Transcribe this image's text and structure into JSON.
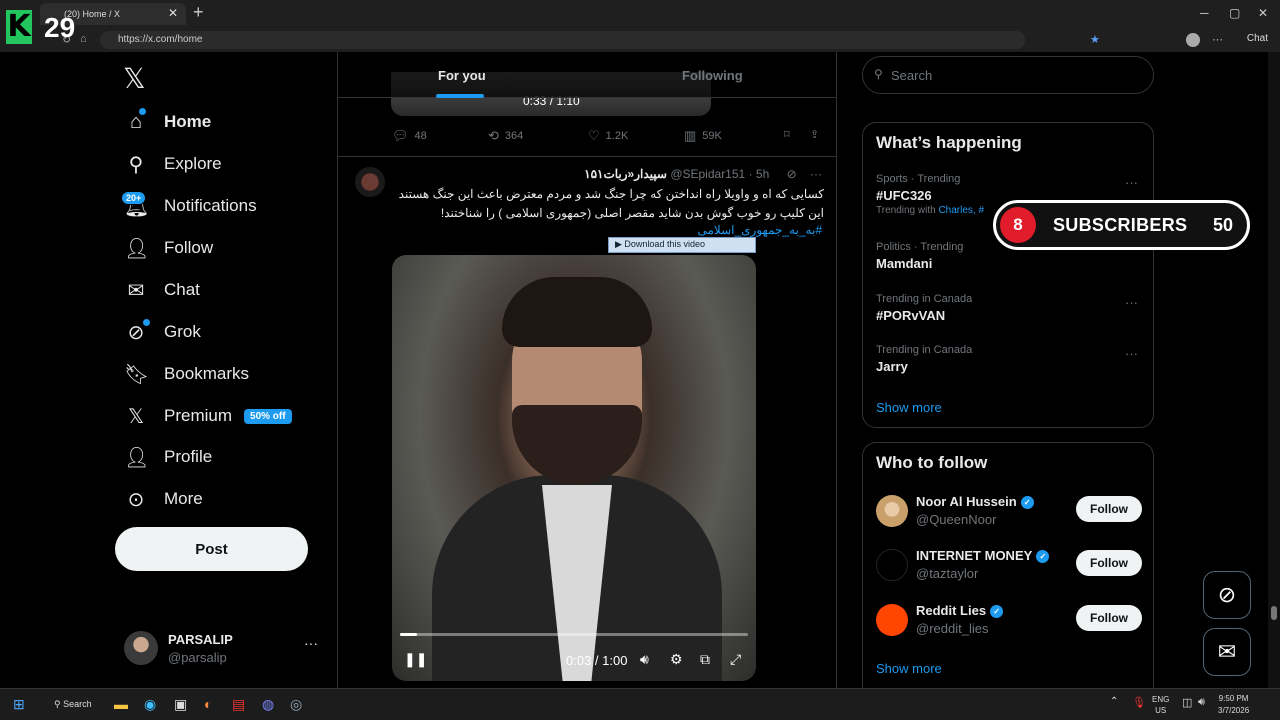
{
  "browser": {
    "tab_title": "(20) Home / X",
    "url": "https://x.com/home",
    "chat_label": "Chat"
  },
  "overlay_top": {
    "k_letter": "K",
    "count": "29"
  },
  "nav": {
    "items": [
      {
        "label": "Home",
        "icon": "home-icon"
      },
      {
        "label": "Explore",
        "icon": "search-icon"
      },
      {
        "label": "Notifications",
        "icon": "bell-icon",
        "badge": "20+"
      },
      {
        "label": "Follow",
        "icon": "person-add-icon"
      },
      {
        "label": "Chat",
        "icon": "mail-icon"
      },
      {
        "label": "Grok",
        "icon": "grok-icon"
      },
      {
        "label": "Bookmarks",
        "icon": "bookmark-icon"
      },
      {
        "label": "Premium",
        "icon": "x-logo-icon",
        "badge": "50% off"
      },
      {
        "label": "Profile",
        "icon": "person-icon"
      },
      {
        "label": "More",
        "icon": "more-circle-icon"
      }
    ],
    "post_label": "Post",
    "user": {
      "name": "PARSALIP",
      "handle": "@parsalip"
    }
  },
  "feed": {
    "tabs": [
      "For you",
      "Following"
    ],
    "prev_post": {
      "video_time": "0:33 / 1:10",
      "replies": "48",
      "reposts": "364",
      "likes": "1.2K",
      "views": "59K"
    },
    "tweet": {
      "name": "سپیدار«ربات۱۵۱",
      "handle": "@SEpidar151",
      "time": "· 5h",
      "text": "کسایی که اه و واویلا راه انداختن که چرا جنگ شد و مردم معترض باعث این جنگ هستند این کلیپ رو خوب گوش بدن شاید مقصر اصلی (جمهوری اسلامی ) را شناختند!",
      "hashtag": "#به_به_جمهوری_اسلامی",
      "download_label": "▶ Download this video",
      "video": {
        "time": "0:03 / 1:00",
        "progress": 0.05
      }
    }
  },
  "sidebar": {
    "search_placeholder": "Search",
    "whats_happening": {
      "title": "What’s happening",
      "trends": [
        {
          "category": "Sports · Trending",
          "name": "#UFC326",
          "sub_prefix": "Trending with",
          "sub_link": "Charles, #"
        },
        {
          "category": "Politics · Trending",
          "name": "Mamdani"
        },
        {
          "category": "Trending in Canada",
          "name": "#PORvVAN"
        },
        {
          "category": "Trending in Canada",
          "name": "Jarry"
        }
      ],
      "show_more": "Show more"
    },
    "who_to_follow": {
      "title": "Who to follow",
      "accounts": [
        {
          "name": "Noor Al Hussein",
          "handle": "@QueenNoor",
          "button": "Follow"
        },
        {
          "name": "INTERNET MONEY",
          "handle": "@taztaylor",
          "button": "Follow"
        },
        {
          "name": "Reddit Lies",
          "handle": "@reddit_lies",
          "button": "Follow"
        }
      ],
      "show_more": "Show more"
    }
  },
  "subscriber_overlay": {
    "left_number": "8",
    "label": "SUBSCRIBERS",
    "count": "50"
  },
  "taskbar": {
    "search_label": "Search",
    "lang_line1": "ENG",
    "lang_line2": "US",
    "time": "9:50 PM",
    "date": "3/7/2026"
  },
  "colors": {
    "accent": "#1d9bf0",
    "background": "#000000",
    "red": "#e11d2b"
  }
}
